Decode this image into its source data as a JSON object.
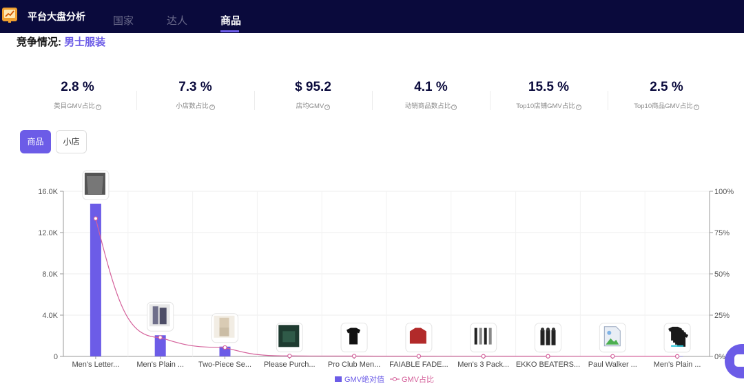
{
  "nav": {
    "brand": "平台大盘分析",
    "tabs": [
      {
        "label": "国家"
      },
      {
        "label": "达人"
      },
      {
        "label": "商品"
      }
    ],
    "active_tab": "商品"
  },
  "competition": {
    "prefix": "竞争情况:",
    "category": "男士服装"
  },
  "stats": [
    {
      "value": "2.8 %",
      "label": "类目GMV占比"
    },
    {
      "value": "7.3 %",
      "label": "小店数占比"
    },
    {
      "value": "$ 95.2",
      "label": "店均GMV"
    },
    {
      "value": "4.1 %",
      "label": "动销商品数占比"
    },
    {
      "value": "15.5 %",
      "label": "Top10店铺GMV占比"
    },
    {
      "value": "2.5 %",
      "label": "Top10商品GMV占比"
    }
  ],
  "toggle": {
    "product_label": "商品",
    "shop_label": "小店",
    "active": "商品"
  },
  "colors": {
    "nav_bg": "#0a0a3c",
    "accent": "#6c5ce7",
    "line": "#d4609a"
  },
  "chart_data": {
    "type": "bar",
    "categories": [
      "Men's Letter...",
      "Men's Plain ...",
      "Two-Piece Se...",
      "Please Purch...",
      "Pro Club Men...",
      "FAIABLE FADE...",
      "Men's 3 Pack...",
      "EKKO BEATERS...",
      "Paul Walker ...",
      "Men's Plain ..."
    ],
    "y_left": {
      "ticks": [
        "0",
        "4.0K",
        "8.0K",
        "12.0K",
        "16.0K"
      ],
      "range": [
        0,
        16000
      ]
    },
    "y_right": {
      "ticks": [
        "0%",
        "25%",
        "50%",
        "75%",
        "100%"
      ],
      "range": [
        0,
        100
      ]
    },
    "series": [
      {
        "name": "GMV绝对值",
        "type": "bar",
        "axis": "left",
        "values": [
          14800,
          2050,
          950,
          45,
          35,
          30,
          25,
          20,
          15,
          10
        ]
      },
      {
        "name": "GMV占比",
        "type": "line",
        "axis": "right",
        "values": [
          83.5,
          11.5,
          5.4,
          0.3,
          0.2,
          0.15,
          0.12,
          0.1,
          0.08,
          0.05
        ]
      }
    ],
    "thumbnails": [
      "sweater",
      "tracksuit",
      "two-piece",
      "dark-tee",
      "black-tee",
      "red-hoodie",
      "three-pants",
      "group-photo",
      "image-placeholder",
      "tee-stack"
    ],
    "legend_position": "bottom"
  }
}
